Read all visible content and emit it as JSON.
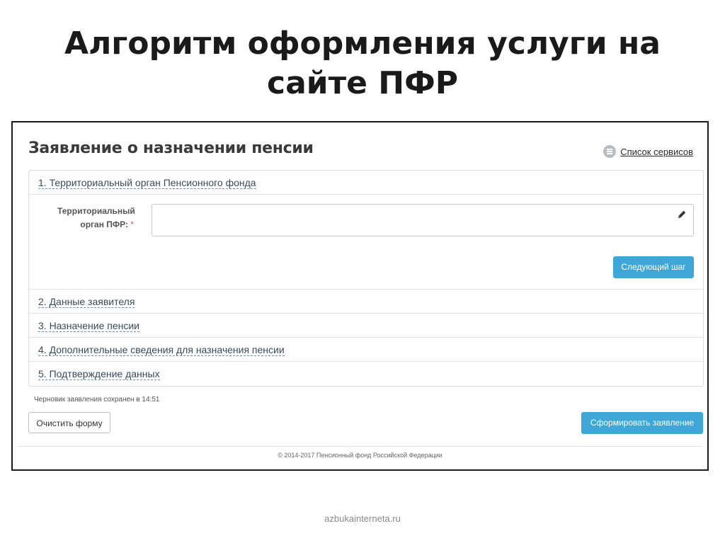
{
  "slide": {
    "title_line1": "Алгоритм оформления услуги на",
    "title_line2": "сайте ПФР",
    "watermark": "azbukainterneta.ru"
  },
  "form": {
    "title": "Заявление о назначении пенсии",
    "services_link": "Список сервисов",
    "services_icon": "list-icon",
    "steps": [
      {
        "label": "1. Территориальный орган Пенсионного фонда"
      },
      {
        "label": "2. Данные заявителя"
      },
      {
        "label": "3. Назначение пенсии"
      },
      {
        "label": "4. Дополнительные сведения для назначения пенсии"
      },
      {
        "label": "5. Подтверждение данных"
      }
    ],
    "field": {
      "label_line1": "Территориальный",
      "label_line2": "орган ПФР:",
      "required_mark": "*",
      "value": "",
      "edit_icon": "pencil-icon"
    },
    "next_button": "Следующий шаг",
    "draft_status": "Черновик заявления сохранен в 14:51",
    "clear_button": "Очистить форму",
    "submit_button": "Сформировать заявление",
    "footer": "© 2014-2017 Пенсионный фонд Российской Федерации",
    "colors": {
      "primary_button": "#3ea7d8",
      "required": "#d9534f"
    }
  }
}
